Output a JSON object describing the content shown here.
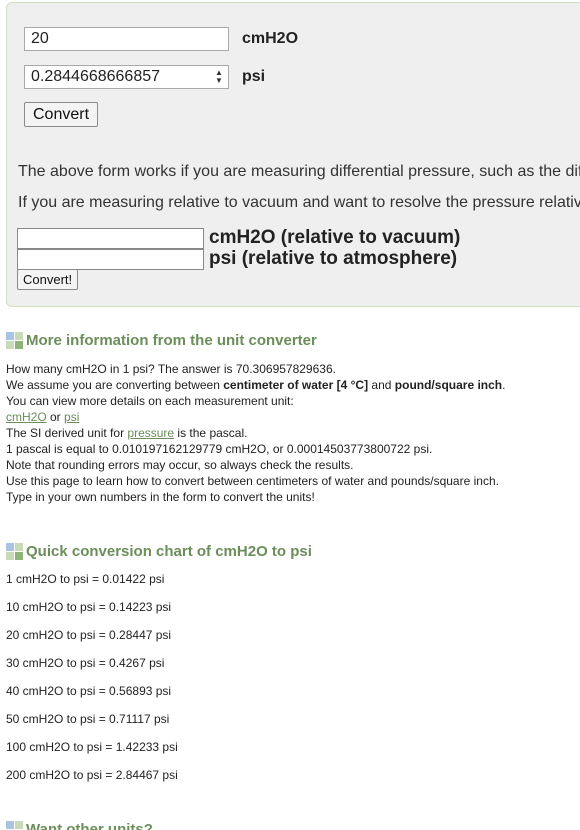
{
  "form": {
    "input_value": "20",
    "input_unit": "cmH2O",
    "output_value": "0.2844668666857",
    "output_unit": "psi",
    "convert_label": "Convert",
    "para1": "The above form works if you are measuring differential pressure, such as the diffe",
    "para2": "If you are measuring relative to vacuum and want to resolve the pressure relative",
    "vac_label_1": "cmH2O (relative to vacuum)",
    "vac_label_2": "psi (relative to atmosphere)",
    "convert2_label": "Convert!"
  },
  "info": {
    "heading": "More information from the unit converter",
    "line1": "How many cmH2O in 1 psi? The answer is 70.306957829636.",
    "line2_a": "We assume you are converting between ",
    "line2_b": "centimeter of water [4 °C]",
    "line2_c": " and ",
    "line2_d": "pound/square inch",
    "line2_e": ".",
    "line3": "You can view more details on each measurement unit:",
    "link_cmh2o": "cmH2O",
    "or_text": " or ",
    "link_psi": "psi",
    "line5_a": "The SI derived unit for ",
    "link_pressure": "pressure",
    "line5_b": " is the pascal.",
    "line6": "1 pascal is equal to 0.010197162129779 cmH2O, or 0.00014503773800722 psi.",
    "line7": "Note that rounding errors may occur, so always check the results.",
    "line8": "Use this page to learn how to convert between centimeters of water and pounds/square inch.",
    "line9": "Type in your own numbers in the form to convert the units!"
  },
  "chart": {
    "heading": "Quick conversion chart of cmH2O to psi",
    "rows": [
      "1 cmH2O to psi = 0.01422 psi",
      "10 cmH2O to psi = 0.14223 psi",
      "20 cmH2O to psi = 0.28447 psi",
      "30 cmH2O to psi = 0.4267 psi",
      "40 cmH2O to psi = 0.56893 psi",
      "50 cmH2O to psi = 0.71117 psi",
      "100 cmH2O to psi = 1.42233 psi",
      "200 cmH2O to psi = 2.84467 psi"
    ]
  },
  "next": {
    "heading": "Want other units?"
  },
  "colors": {
    "accent": "#6b8e5a",
    "panel": "#efefef"
  }
}
